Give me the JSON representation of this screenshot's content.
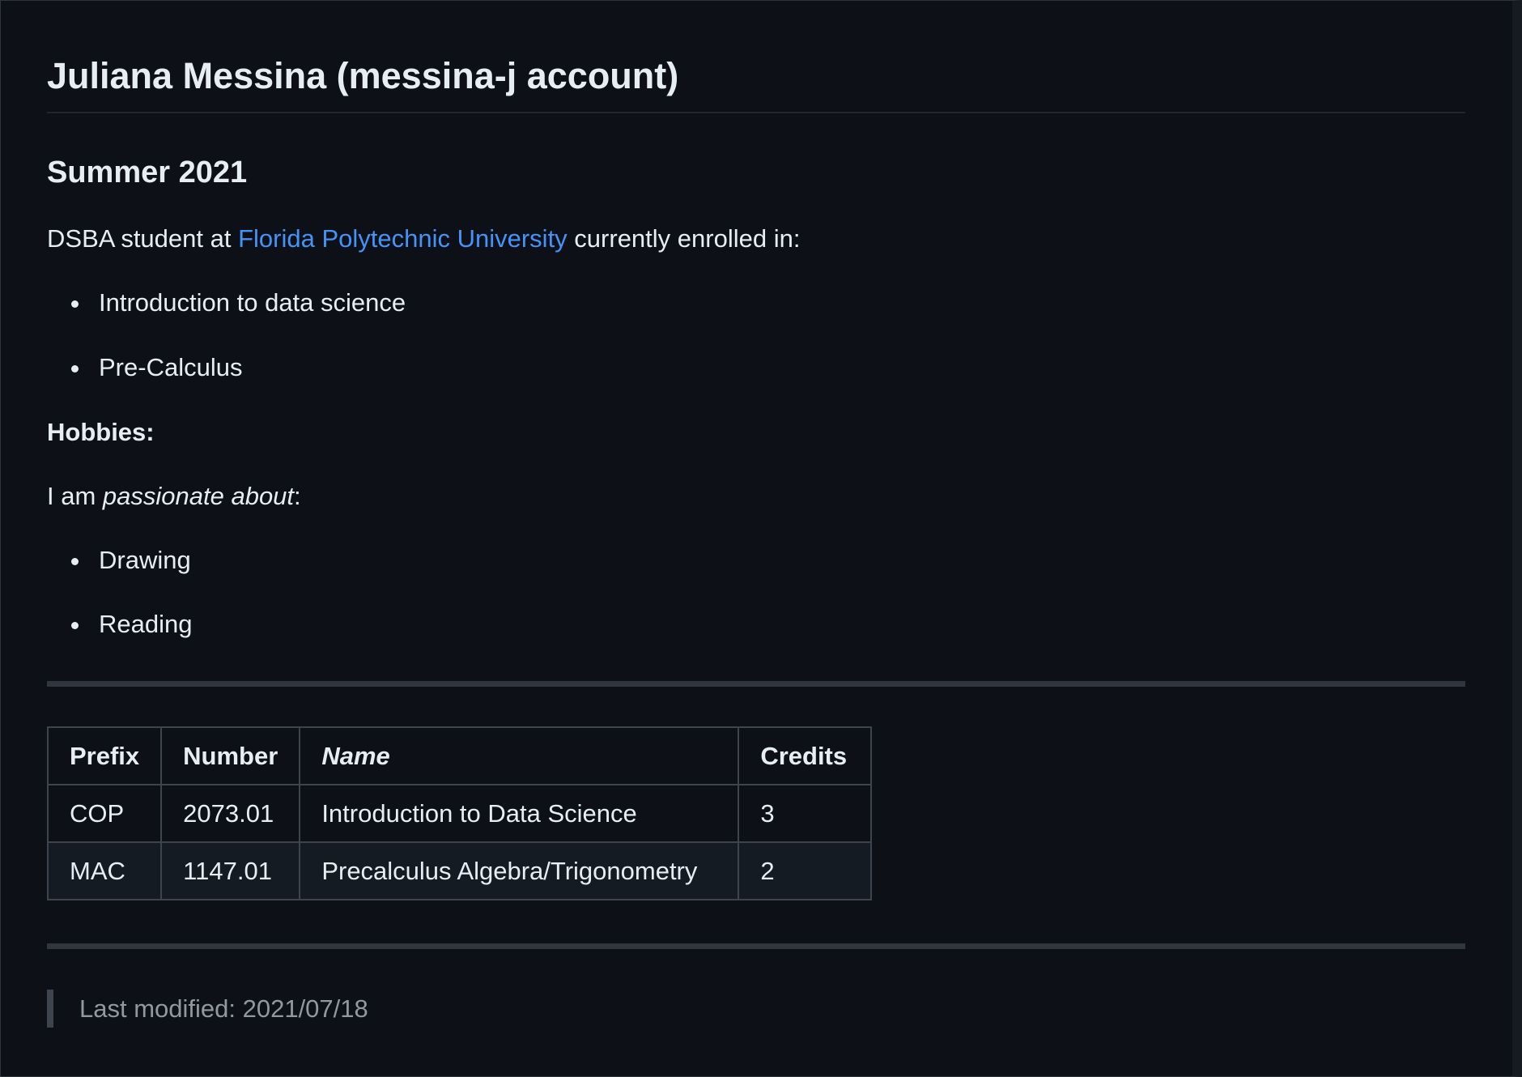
{
  "title": "Juliana Messina (messina-j account)",
  "term": "Summer 2021",
  "intro": {
    "before": "DSBA student at ",
    "link": "Florida Polytechnic University",
    "after": " currently enrolled in:"
  },
  "courses_list": [
    "Introduction to data science",
    "Pre-Calculus"
  ],
  "hobbies_heading": "Hobbies:",
  "passion": {
    "before": "I am ",
    "em": "passionate about",
    "after": ":"
  },
  "hobbies_list": [
    "Drawing",
    "Reading"
  ],
  "table": {
    "headers": [
      "Prefix",
      "Number",
      "Name",
      "Credits"
    ],
    "rows": [
      [
        "COP",
        "2073.01",
        "Introduction to Data Science",
        "3"
      ],
      [
        "MAC",
        "1147.01",
        "Precalculus Algebra/Trigonometry",
        "2"
      ]
    ]
  },
  "last_modified": "Last modified: 2021/07/18",
  "colors": {
    "background": "#0d1117",
    "text": "#e6edf3",
    "link": "#4493f8",
    "muted": "#9198a1"
  }
}
